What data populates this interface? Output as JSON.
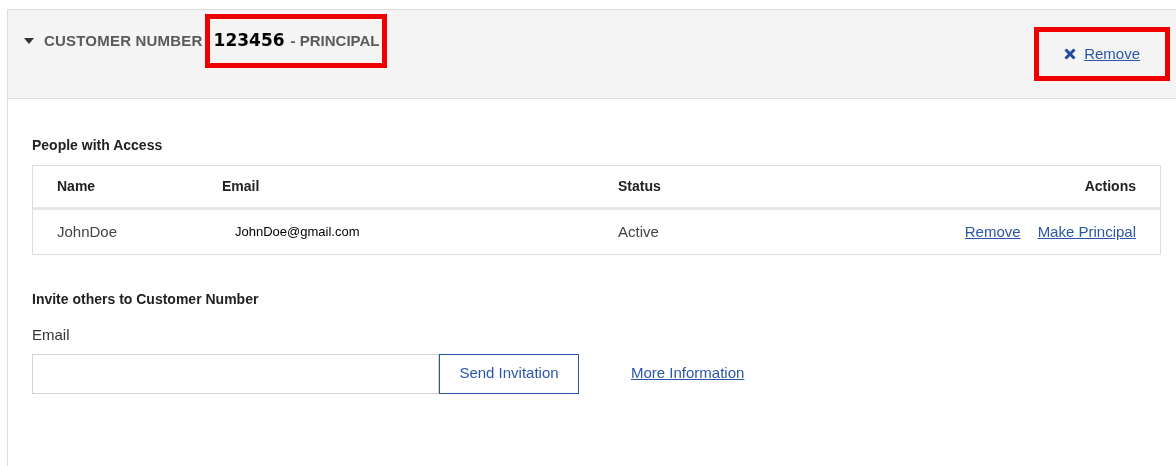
{
  "header": {
    "expanded": true,
    "label": "CUSTOMER NUMBER",
    "number": "123456",
    "suffix": "- PRINCIPAL",
    "number_highlighted": true,
    "remove": {
      "label": "Remove",
      "highlighted": true
    }
  },
  "people": {
    "title": "People with Access",
    "columns": [
      "Name",
      "Email",
      "Status",
      "Actions"
    ],
    "rows": [
      {
        "name": "JohnDoe",
        "email": "JohnDoe@gmail.com",
        "status": "Active",
        "actions": [
          "Remove",
          "Make Principal"
        ]
      }
    ]
  },
  "invite": {
    "title": "Invite others to Customer Number",
    "email_label": "Email",
    "button": "Send Invitation",
    "link": "More Information"
  }
}
